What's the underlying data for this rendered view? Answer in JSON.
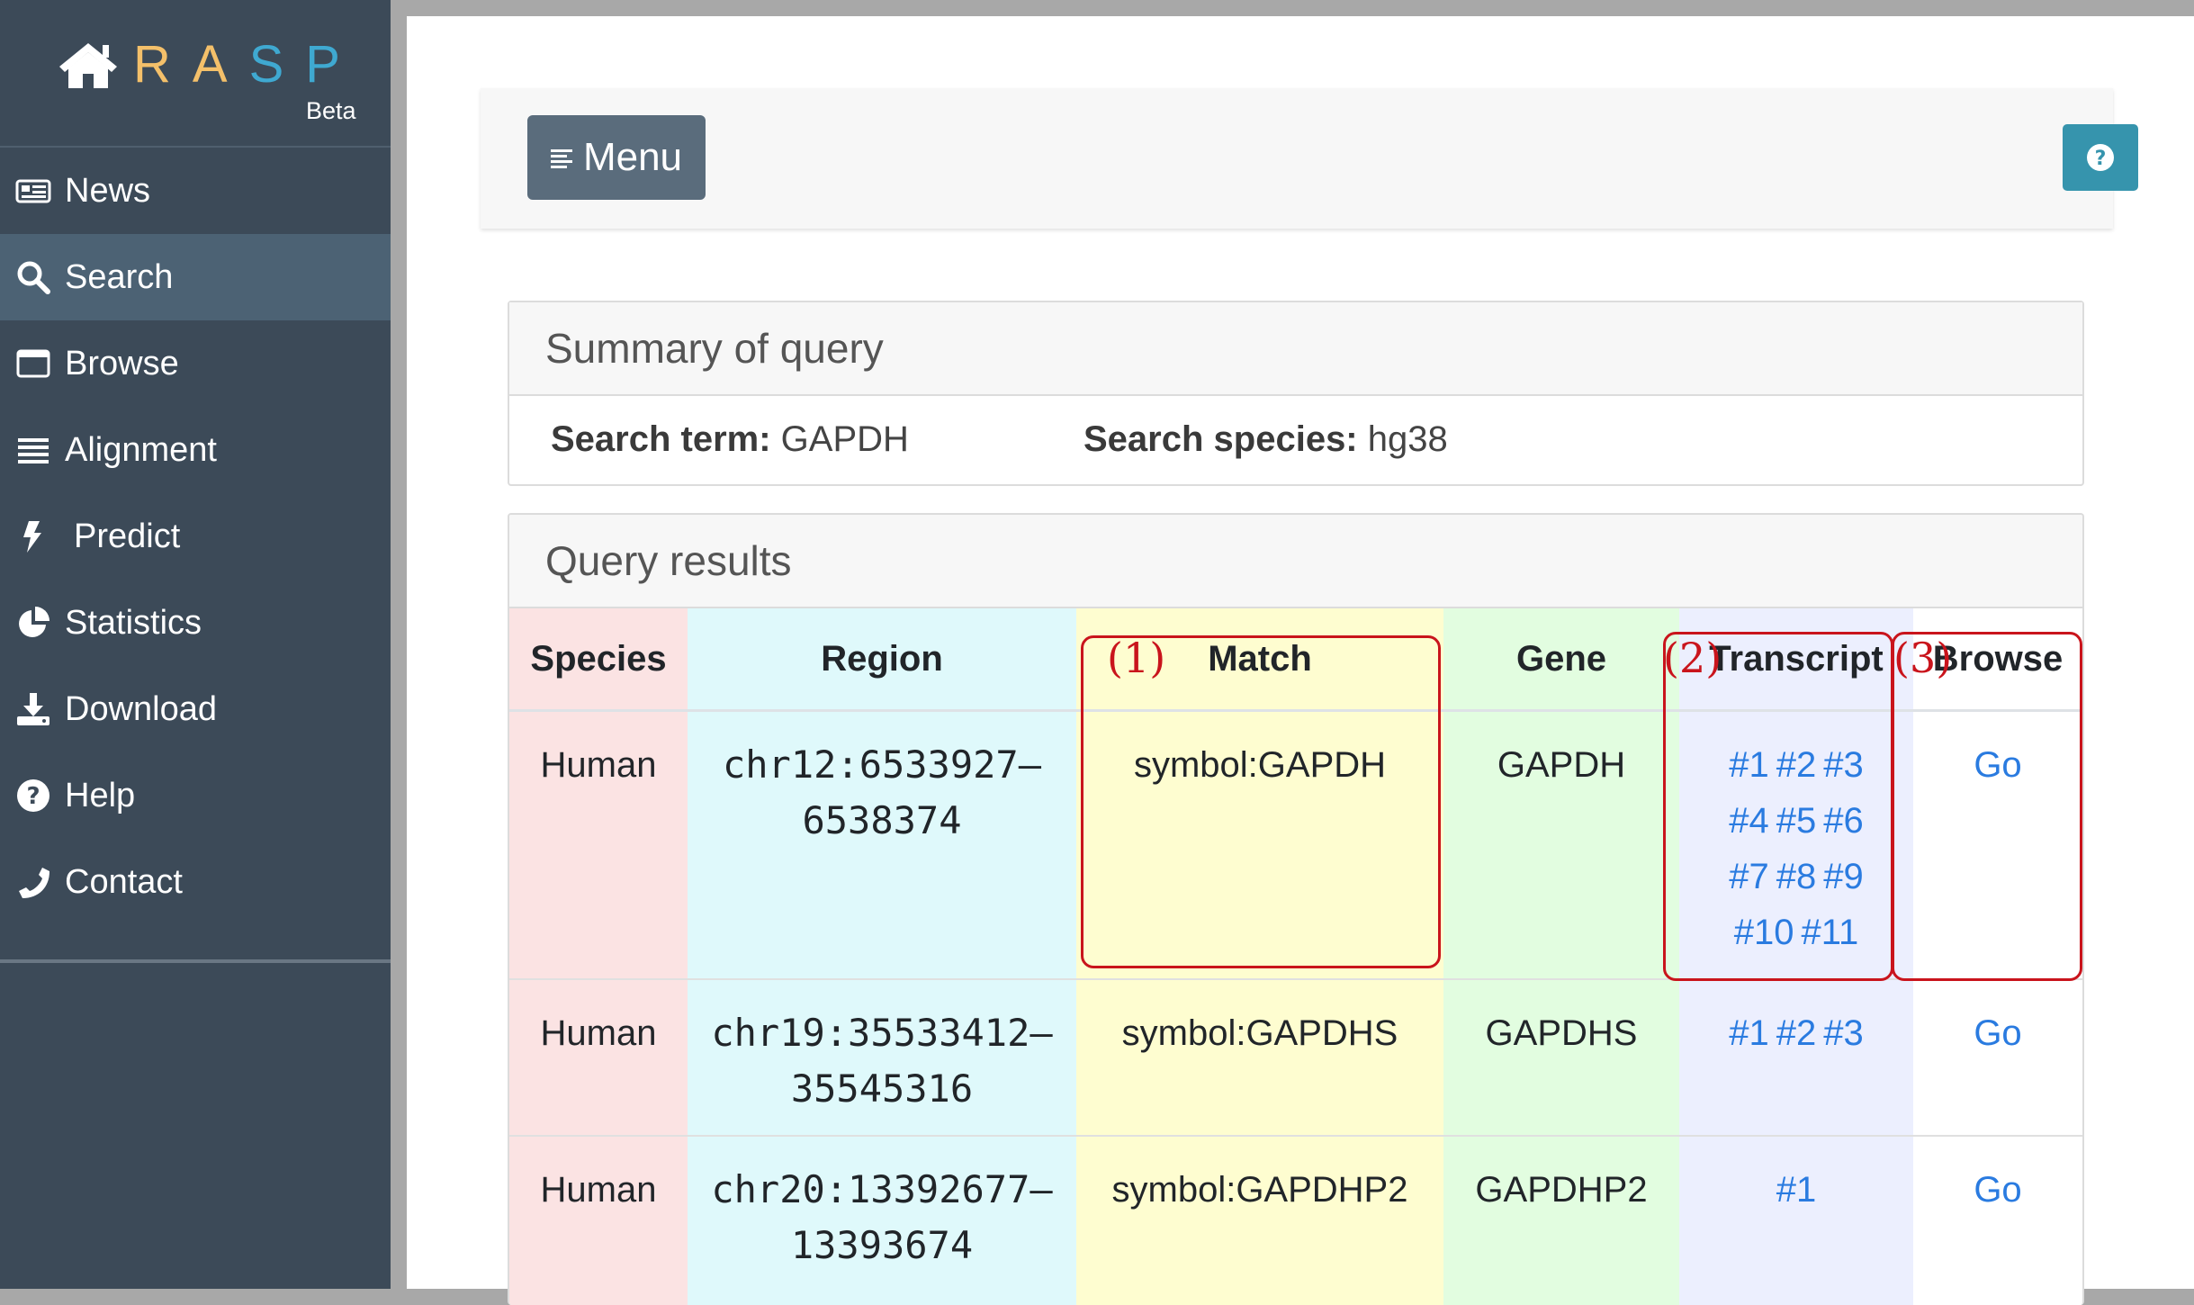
{
  "app": {
    "logo_letters": [
      "R",
      "A",
      "S",
      "P"
    ],
    "logo_letter_colors": [
      "#f4c06a",
      "#f4c06a",
      "#3fa9d1",
      "#3fa9d1"
    ],
    "beta": "Beta"
  },
  "sidebar": {
    "items": [
      {
        "label": "News",
        "icon": "newspaper-icon"
      },
      {
        "label": "Search",
        "icon": "search-icon",
        "active": true
      },
      {
        "label": "Browse",
        "icon": "window-icon"
      },
      {
        "label": "Alignment",
        "icon": "list-icon"
      },
      {
        "label": "Predict",
        "icon": "bolt-icon"
      },
      {
        "label": "Statistics",
        "icon": "pie-chart-icon"
      },
      {
        "label": "Download",
        "icon": "download-icon"
      },
      {
        "label": "Help",
        "icon": "question-circle-icon"
      },
      {
        "label": "Contact",
        "icon": "phone-icon"
      }
    ]
  },
  "toolbar": {
    "menu_label": "Menu"
  },
  "summary": {
    "title": "Summary of query",
    "term_label": "Search term:",
    "term_value": " GAPDH",
    "species_label": "Search species:",
    "species_value": " hg38"
  },
  "results": {
    "title": "Query results",
    "headers": [
      "Species",
      "Region",
      "Match",
      "Gene",
      "Transcript",
      "Browse"
    ],
    "rows": [
      {
        "species": "Human",
        "region_1": "chr12:6533927–",
        "region_2": "6538374",
        "match": "symbol:GAPDH",
        "gene": "GAPDH",
        "transcripts": [
          [
            "#1",
            "#2",
            "#3"
          ],
          [
            "#4",
            "#5",
            "#6"
          ],
          [
            "#7",
            "#8",
            "#9"
          ],
          [
            "#10",
            "#11"
          ]
        ],
        "browse": "Go"
      },
      {
        "species": "Human",
        "region_1": "chr19:35533412–",
        "region_2": "35545316",
        "match": "symbol:GAPDHS",
        "gene": "GAPDHS",
        "transcripts": [
          [
            "#1",
            "#2",
            "#3"
          ]
        ],
        "browse": "Go"
      },
      {
        "species": "Human",
        "region_1": "chr20:13392677–",
        "region_2": "13393674",
        "match": "symbol:GAPDHP2",
        "gene": "GAPDHP2",
        "transcripts": [
          [
            "#1"
          ]
        ],
        "browse": "Go"
      }
    ]
  },
  "annotations": {
    "labels": [
      "(1)",
      "(2)",
      "(3)"
    ],
    "color": "#c9141c"
  }
}
